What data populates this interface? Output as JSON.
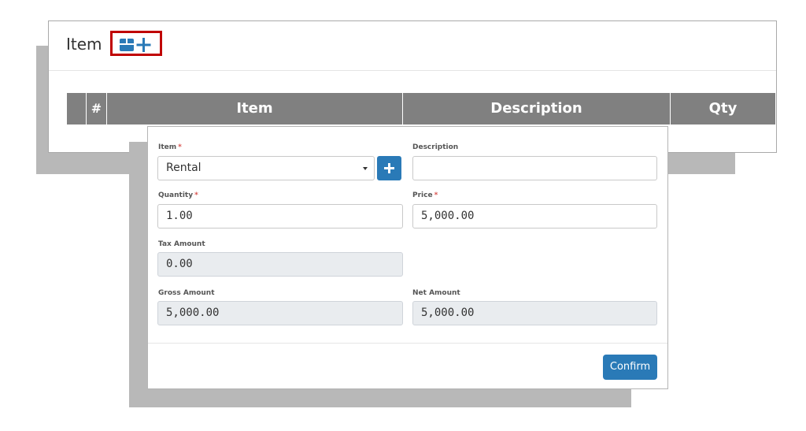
{
  "card": {
    "title": "Item",
    "add_icons": [
      "box-icon",
      "plus-icon"
    ]
  },
  "table": {
    "columns": [
      "#",
      "Item",
      "Description",
      "Qty"
    ]
  },
  "modal": {
    "item_label": "Item",
    "item_value": "Rental",
    "description_label": "Description",
    "description_value": "",
    "quantity_label": "Quantity",
    "quantity_value": "1.00",
    "price_label": "Price",
    "price_value": "5,000.00",
    "tax_label": "Tax Amount",
    "tax_value": "0.00",
    "gross_label": "Gross Amount",
    "gross_value": "5,000.00",
    "net_label": "Net Amount",
    "net_value": "5,000.00",
    "required_mark": "*",
    "confirm_label": "Confirm"
  },
  "colors": {
    "accent": "#2a7ab7",
    "highlight_border": "#c00000",
    "table_header": "#808080",
    "required": "#d9534f"
  }
}
